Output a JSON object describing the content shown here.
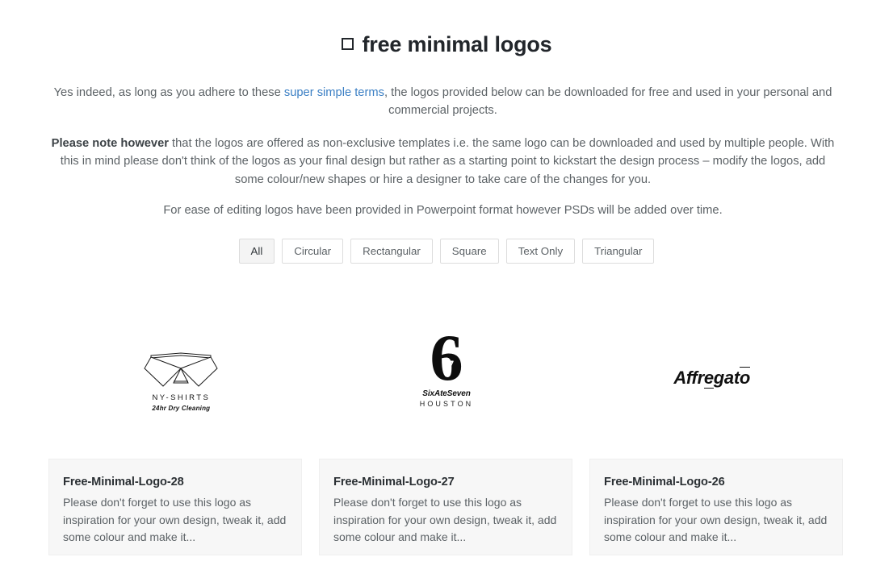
{
  "header": {
    "title": "free minimal logos",
    "title_icon": "missing-glyph-box-icon"
  },
  "intro": {
    "paragraph_1": {
      "before_link": "Yes indeed, as long as you adhere to these ",
      "link_text": "super simple terms",
      "after_link": ", the logos provided below can be downloaded for free and used in your personal and commercial projects."
    },
    "paragraph_2": {
      "strong_text": "Please note however",
      "rest_text": " that the logos are offered as non-exclusive templates i.e. the same logo can be downloaded and used by multiple people. With this in mind please don't think of the logos as your final design but rather as a starting point to kickstart the design process – modify the logos, add some colour/new shapes or hire a designer to take care of the changes for you."
    },
    "paragraph_3": "For ease of editing logos have been provided in Powerpoint format however PSDs will be added over time."
  },
  "filters": {
    "active": "All",
    "items": [
      {
        "label": "All",
        "active": true
      },
      {
        "label": "Circular",
        "active": false
      },
      {
        "label": "Rectangular",
        "active": false
      },
      {
        "label": "Square",
        "active": false
      },
      {
        "label": "Text Only",
        "active": false
      },
      {
        "label": "Triangular",
        "active": false
      }
    ]
  },
  "logos": [
    {
      "id": "ny-shirts",
      "mark": "shirt-collar-icon",
      "name": "NY-SHIRTS",
      "tagline": "24hr Dry Cleaning"
    },
    {
      "id": "sixateseven",
      "mark": "six-seven-numeral-icon",
      "name": "SixAteSeven",
      "tagline": "HOUSTON"
    },
    {
      "id": "affregato",
      "mark": "affregato-wordmark-icon",
      "wordmark_part_1": "Affr",
      "wordmark_part_2": "e",
      "wordmark_part_3": "gat",
      "wordmark_part_4": "o"
    }
  ],
  "cards": [
    {
      "title": "Free-Minimal-Logo-28",
      "description": "Please don't forget to use this logo as inspiration for your own design, tweak it, add some colour and make it..."
    },
    {
      "title": "Free-Minimal-Logo-27",
      "description": "Please don't forget to use this logo as inspiration for your own design, tweak it, add some colour and make it..."
    },
    {
      "title": "Free-Minimal-Logo-26",
      "description": "Please don't forget to use this logo as inspiration for your own design, tweak it, add some colour and make it..."
    }
  ],
  "colors": {
    "page_background": "#ffffff",
    "body_text": "#5c6266",
    "heading_text": "#22262b",
    "link": "#3b7fc4",
    "card_background": "#f7f7f7",
    "card_border": "#efefef",
    "button_border": "#dddddd",
    "button_active_background": "#f4f4f4"
  }
}
